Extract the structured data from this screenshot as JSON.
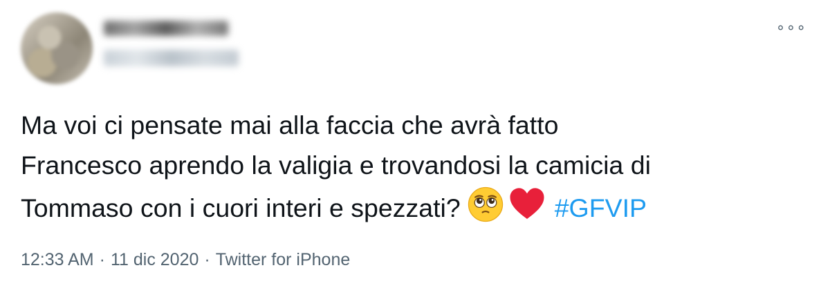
{
  "tweet": {
    "author": {
      "display_name": "",
      "handle": ""
    },
    "more_icon": "more-icon",
    "text_lines": [
      "Ma voi ci pensate mai alla faccia che avrà fatto",
      "Francesco aprendo la valigia e trovandosi la camicia di",
      "Tommaso con i cuori interi e spezzati?"
    ],
    "emojis": [
      "pleading-face-icon",
      "red-heart-icon"
    ],
    "hashtag": "#GFVIP",
    "time": "12:33 AM",
    "separator": "·",
    "date": "11 dic 2020",
    "source": "Twitter for iPhone",
    "colors": {
      "text": "#0f1419",
      "secondary": "#536471",
      "link": "#1d9bf0",
      "heart": "#e8203a",
      "emoji_face": "#ffcc33"
    }
  }
}
